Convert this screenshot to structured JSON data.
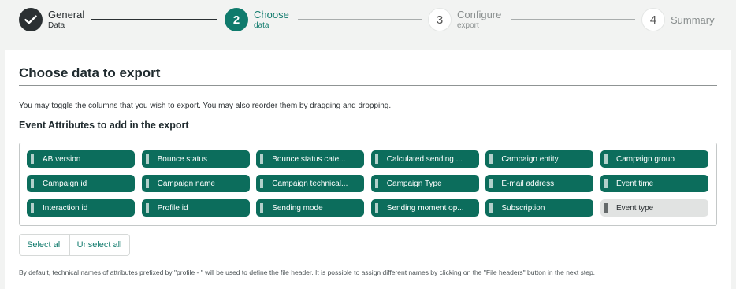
{
  "stepper": {
    "steps": [
      {
        "number": "",
        "title": "General",
        "subtitle": "Data",
        "state": "done"
      },
      {
        "number": "2",
        "title": "Choose",
        "subtitle": "data",
        "state": "active"
      },
      {
        "number": "3",
        "title": "Configure",
        "subtitle": "export",
        "state": "todo"
      },
      {
        "number": "4",
        "title": "Summary",
        "subtitle": "",
        "state": "todo"
      }
    ]
  },
  "card": {
    "title": "Choose data to export",
    "description": "You may toggle the columns that you wish to export. You may also reorder them by dragging and dropping.",
    "section_title": "Event Attributes to add in the export",
    "attributes": [
      {
        "label": "AB version",
        "selected": true
      },
      {
        "label": "Bounce status",
        "selected": true
      },
      {
        "label": "Bounce status cate...",
        "selected": true
      },
      {
        "label": "Calculated sending ...",
        "selected": true
      },
      {
        "label": "Campaign entity",
        "selected": true
      },
      {
        "label": "Campaign group",
        "selected": true
      },
      {
        "label": "Campaign id",
        "selected": true
      },
      {
        "label": "Campaign name",
        "selected": true
      },
      {
        "label": "Campaign technical...",
        "selected": true
      },
      {
        "label": "Campaign Type",
        "selected": true
      },
      {
        "label": "E-mail address",
        "selected": true
      },
      {
        "label": "Event time",
        "selected": true
      },
      {
        "label": "Interaction id",
        "selected": true
      },
      {
        "label": "Profile id",
        "selected": true
      },
      {
        "label": "Sending mode",
        "selected": true
      },
      {
        "label": "Sending moment op...",
        "selected": true
      },
      {
        "label": "Subscription",
        "selected": true
      },
      {
        "label": "Event type",
        "selected": false
      }
    ],
    "select_all_label": "Select all",
    "unselect_all_label": "Unselect all",
    "footnote": "By default, technical names of attributes prefixed by \"profile - \" will be used to define the file header. It is possible to assign different names by clicking on the \"File headers\" button in the next step."
  },
  "colors": {
    "accent": "#0f7a6c",
    "chip_selected": "#0c6d5c",
    "chip_unselected": "#e1e3e2",
    "step_done": "#2b3033"
  },
  "icons": {
    "step_done": "check-icon",
    "chip_handle": "drag-handle-icon"
  }
}
